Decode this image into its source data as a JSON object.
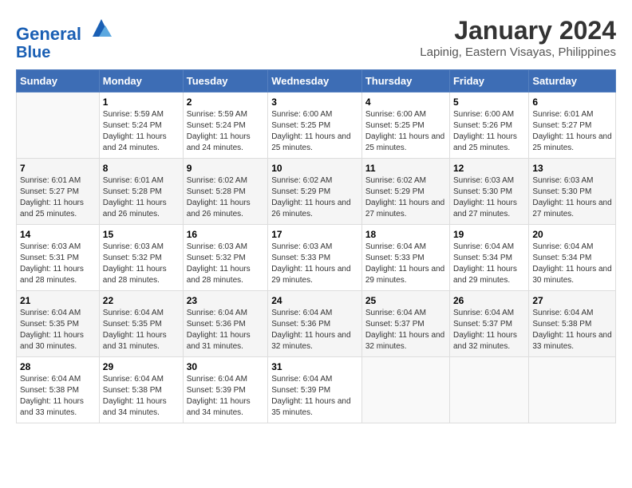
{
  "header": {
    "logo_line1": "General",
    "logo_line2": "Blue",
    "month_title": "January 2024",
    "location": "Lapinig, Eastern Visayas, Philippines"
  },
  "days_of_week": [
    "Sunday",
    "Monday",
    "Tuesday",
    "Wednesday",
    "Thursday",
    "Friday",
    "Saturday"
  ],
  "weeks": [
    [
      {
        "day": "",
        "sunrise": "",
        "sunset": "",
        "daylight": ""
      },
      {
        "day": "1",
        "sunrise": "Sunrise: 5:59 AM",
        "sunset": "Sunset: 5:24 PM",
        "daylight": "Daylight: 11 hours and 24 minutes."
      },
      {
        "day": "2",
        "sunrise": "Sunrise: 5:59 AM",
        "sunset": "Sunset: 5:24 PM",
        "daylight": "Daylight: 11 hours and 24 minutes."
      },
      {
        "day": "3",
        "sunrise": "Sunrise: 6:00 AM",
        "sunset": "Sunset: 5:25 PM",
        "daylight": "Daylight: 11 hours and 25 minutes."
      },
      {
        "day": "4",
        "sunrise": "Sunrise: 6:00 AM",
        "sunset": "Sunset: 5:25 PM",
        "daylight": "Daylight: 11 hours and 25 minutes."
      },
      {
        "day": "5",
        "sunrise": "Sunrise: 6:00 AM",
        "sunset": "Sunset: 5:26 PM",
        "daylight": "Daylight: 11 hours and 25 minutes."
      },
      {
        "day": "6",
        "sunrise": "Sunrise: 6:01 AM",
        "sunset": "Sunset: 5:27 PM",
        "daylight": "Daylight: 11 hours and 25 minutes."
      }
    ],
    [
      {
        "day": "7",
        "sunrise": "Sunrise: 6:01 AM",
        "sunset": "Sunset: 5:27 PM",
        "daylight": "Daylight: 11 hours and 25 minutes."
      },
      {
        "day": "8",
        "sunrise": "Sunrise: 6:01 AM",
        "sunset": "Sunset: 5:28 PM",
        "daylight": "Daylight: 11 hours and 26 minutes."
      },
      {
        "day": "9",
        "sunrise": "Sunrise: 6:02 AM",
        "sunset": "Sunset: 5:28 PM",
        "daylight": "Daylight: 11 hours and 26 minutes."
      },
      {
        "day": "10",
        "sunrise": "Sunrise: 6:02 AM",
        "sunset": "Sunset: 5:29 PM",
        "daylight": "Daylight: 11 hours and 26 minutes."
      },
      {
        "day": "11",
        "sunrise": "Sunrise: 6:02 AM",
        "sunset": "Sunset: 5:29 PM",
        "daylight": "Daylight: 11 hours and 27 minutes."
      },
      {
        "day": "12",
        "sunrise": "Sunrise: 6:03 AM",
        "sunset": "Sunset: 5:30 PM",
        "daylight": "Daylight: 11 hours and 27 minutes."
      },
      {
        "day": "13",
        "sunrise": "Sunrise: 6:03 AM",
        "sunset": "Sunset: 5:30 PM",
        "daylight": "Daylight: 11 hours and 27 minutes."
      }
    ],
    [
      {
        "day": "14",
        "sunrise": "Sunrise: 6:03 AM",
        "sunset": "Sunset: 5:31 PM",
        "daylight": "Daylight: 11 hours and 28 minutes."
      },
      {
        "day": "15",
        "sunrise": "Sunrise: 6:03 AM",
        "sunset": "Sunset: 5:32 PM",
        "daylight": "Daylight: 11 hours and 28 minutes."
      },
      {
        "day": "16",
        "sunrise": "Sunrise: 6:03 AM",
        "sunset": "Sunset: 5:32 PM",
        "daylight": "Daylight: 11 hours and 28 minutes."
      },
      {
        "day": "17",
        "sunrise": "Sunrise: 6:03 AM",
        "sunset": "Sunset: 5:33 PM",
        "daylight": "Daylight: 11 hours and 29 minutes."
      },
      {
        "day": "18",
        "sunrise": "Sunrise: 6:04 AM",
        "sunset": "Sunset: 5:33 PM",
        "daylight": "Daylight: 11 hours and 29 minutes."
      },
      {
        "day": "19",
        "sunrise": "Sunrise: 6:04 AM",
        "sunset": "Sunset: 5:34 PM",
        "daylight": "Daylight: 11 hours and 29 minutes."
      },
      {
        "day": "20",
        "sunrise": "Sunrise: 6:04 AM",
        "sunset": "Sunset: 5:34 PM",
        "daylight": "Daylight: 11 hours and 30 minutes."
      }
    ],
    [
      {
        "day": "21",
        "sunrise": "Sunrise: 6:04 AM",
        "sunset": "Sunset: 5:35 PM",
        "daylight": "Daylight: 11 hours and 30 minutes."
      },
      {
        "day": "22",
        "sunrise": "Sunrise: 6:04 AM",
        "sunset": "Sunset: 5:35 PM",
        "daylight": "Daylight: 11 hours and 31 minutes."
      },
      {
        "day": "23",
        "sunrise": "Sunrise: 6:04 AM",
        "sunset": "Sunset: 5:36 PM",
        "daylight": "Daylight: 11 hours and 31 minutes."
      },
      {
        "day": "24",
        "sunrise": "Sunrise: 6:04 AM",
        "sunset": "Sunset: 5:36 PM",
        "daylight": "Daylight: 11 hours and 32 minutes."
      },
      {
        "day": "25",
        "sunrise": "Sunrise: 6:04 AM",
        "sunset": "Sunset: 5:37 PM",
        "daylight": "Daylight: 11 hours and 32 minutes."
      },
      {
        "day": "26",
        "sunrise": "Sunrise: 6:04 AM",
        "sunset": "Sunset: 5:37 PM",
        "daylight": "Daylight: 11 hours and 32 minutes."
      },
      {
        "day": "27",
        "sunrise": "Sunrise: 6:04 AM",
        "sunset": "Sunset: 5:38 PM",
        "daylight": "Daylight: 11 hours and 33 minutes."
      }
    ],
    [
      {
        "day": "28",
        "sunrise": "Sunrise: 6:04 AM",
        "sunset": "Sunset: 5:38 PM",
        "daylight": "Daylight: 11 hours and 33 minutes."
      },
      {
        "day": "29",
        "sunrise": "Sunrise: 6:04 AM",
        "sunset": "Sunset: 5:38 PM",
        "daylight": "Daylight: 11 hours and 34 minutes."
      },
      {
        "day": "30",
        "sunrise": "Sunrise: 6:04 AM",
        "sunset": "Sunset: 5:39 PM",
        "daylight": "Daylight: 11 hours and 34 minutes."
      },
      {
        "day": "31",
        "sunrise": "Sunrise: 6:04 AM",
        "sunset": "Sunset: 5:39 PM",
        "daylight": "Daylight: 11 hours and 35 minutes."
      },
      {
        "day": "",
        "sunrise": "",
        "sunset": "",
        "daylight": ""
      },
      {
        "day": "",
        "sunrise": "",
        "sunset": "",
        "daylight": ""
      },
      {
        "day": "",
        "sunrise": "",
        "sunset": "",
        "daylight": ""
      }
    ]
  ]
}
